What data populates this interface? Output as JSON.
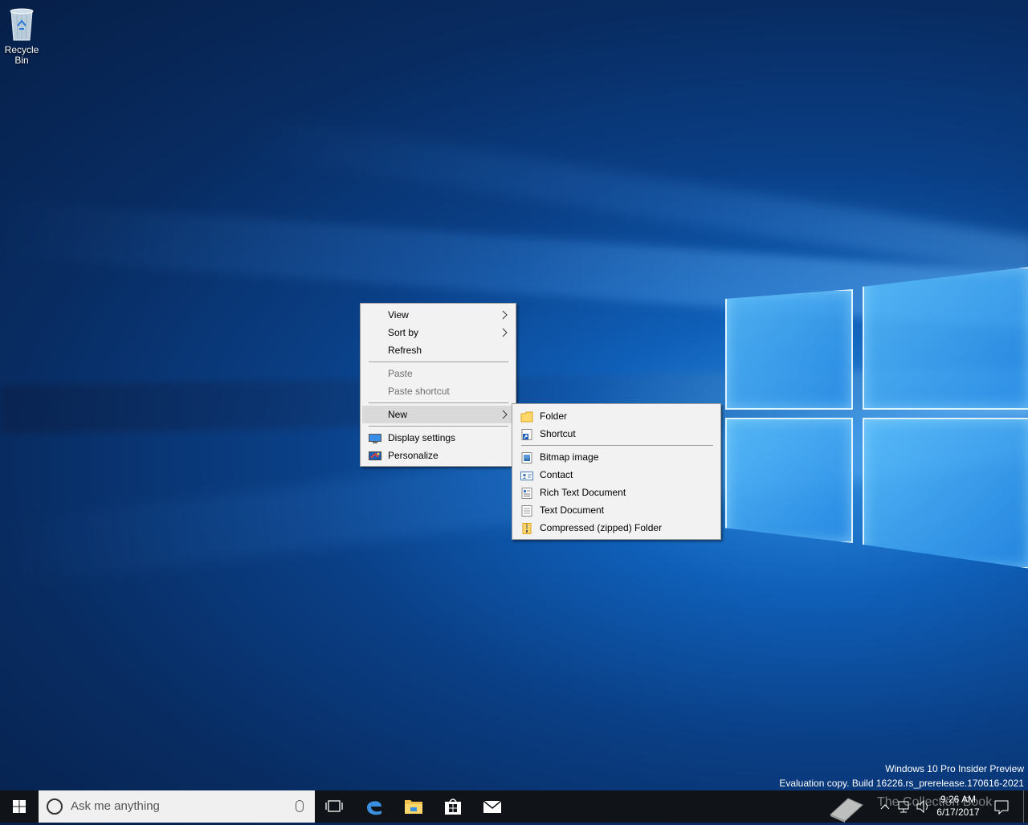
{
  "desktop": {
    "icons": [
      {
        "label": "Recycle Bin",
        "icon": "recycle-bin-icon"
      }
    ]
  },
  "context_menu": {
    "items": [
      {
        "label": "View",
        "submenu": true
      },
      {
        "label": "Sort by",
        "submenu": true
      },
      {
        "label": "Refresh"
      },
      {
        "label": "Paste",
        "disabled": true
      },
      {
        "label": "Paste shortcut",
        "disabled": true
      },
      {
        "label": "New",
        "submenu": true,
        "highlighted": true
      },
      {
        "label": "Display settings",
        "icon": "display-icon"
      },
      {
        "label": "Personalize",
        "icon": "personalize-icon"
      }
    ],
    "submenu_arrow": ">"
  },
  "new_submenu": {
    "items": [
      {
        "label": "Folder",
        "icon": "folder-icon"
      },
      {
        "label": "Shortcut",
        "icon": "shortcut-icon"
      },
      {
        "label": "Bitmap image",
        "icon": "bitmap-icon"
      },
      {
        "label": "Contact",
        "icon": "contact-icon"
      },
      {
        "label": "Rich Text Document",
        "icon": "rich-text-icon"
      },
      {
        "label": "Text Document",
        "icon": "text-document-icon"
      },
      {
        "label": "Compressed (zipped) Folder",
        "icon": "zip-folder-icon"
      }
    ]
  },
  "watermark": {
    "line1": "Windows 10 Pro Insider Preview",
    "line2": "Evaluation copy. Build 16226.rs_prerelease.170616-2021"
  },
  "taskbar": {
    "search_placeholder": "Ask me anything",
    "pinned": [
      "task-view-icon",
      "edge-icon",
      "file-explorer-icon",
      "store-icon",
      "mail-icon"
    ],
    "tray_overlay_text": "The Collection Book",
    "clock_time": "9:26 AM",
    "clock_date": "6/17/2017"
  },
  "colors": {
    "accent": "#0078d7",
    "menu_bg": "#f2f2f2",
    "menu_highlight": "#d9d9d9",
    "taskbar_bg": "#101418"
  }
}
